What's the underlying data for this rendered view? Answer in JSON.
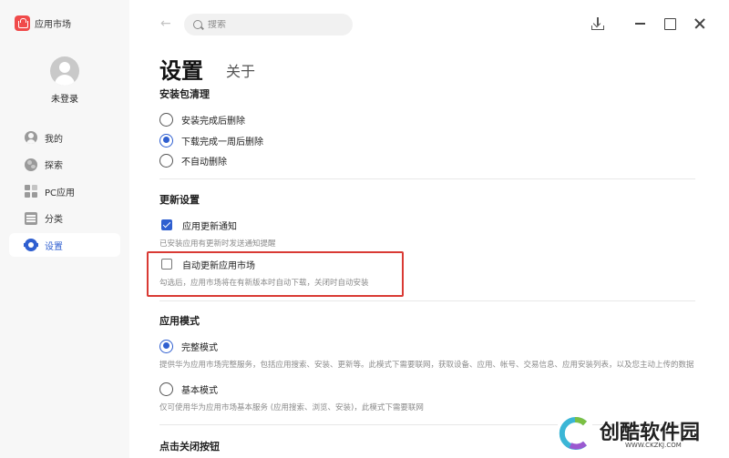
{
  "app": {
    "name": "应用市场"
  },
  "user": {
    "login_label": "未登录"
  },
  "sidebar": {
    "items": [
      {
        "label": "我的",
        "icon": "person-icon"
      },
      {
        "label": "探索",
        "icon": "globe-icon"
      },
      {
        "label": "PC应用",
        "icon": "grid-icon"
      },
      {
        "label": "分类",
        "icon": "category-icon"
      },
      {
        "label": "设置",
        "icon": "gear-icon",
        "active": true
      }
    ]
  },
  "search": {
    "placeholder": "搜索"
  },
  "tabs": {
    "settings": "设置",
    "about": "关于"
  },
  "install_cleanup": {
    "title": "安装包清理",
    "options": [
      {
        "label": "安装完成后删除",
        "checked": false
      },
      {
        "label": "下载完成一周后删除",
        "checked": true
      },
      {
        "label": "不自动删除",
        "checked": false
      }
    ]
  },
  "update_settings": {
    "title": "更新设置",
    "notify": {
      "label": "应用更新通知",
      "checked": true,
      "hint": "已安装应用有更新时发送通知提醒"
    },
    "auto_update": {
      "label": "自动更新应用市场",
      "checked": false,
      "hint": "勾选后，应用市场将在有新版本时自动下载，关闭时自动安装"
    }
  },
  "app_mode": {
    "title": "应用模式",
    "full": {
      "label": "完整模式",
      "checked": true,
      "hint": "提供华为应用市场完整服务，包括应用搜索、安装、更新等。此模式下需要联网，获取设备、应用、帐号、交易信息、应用安装列表，以及您主动上传的数据"
    },
    "basic": {
      "label": "基本模式",
      "checked": false,
      "hint": "仅可使用华为应用市场基本服务 (应用搜索、浏览、安装)，此模式下需要联网"
    }
  },
  "close_button": {
    "title": "点击关闭按钮"
  },
  "watermark": {
    "text": "创酷软件园",
    "url": "WWW.CKZKJ.COM"
  },
  "colors": {
    "accent": "#2f5fd0",
    "highlight": "#d93a34"
  }
}
